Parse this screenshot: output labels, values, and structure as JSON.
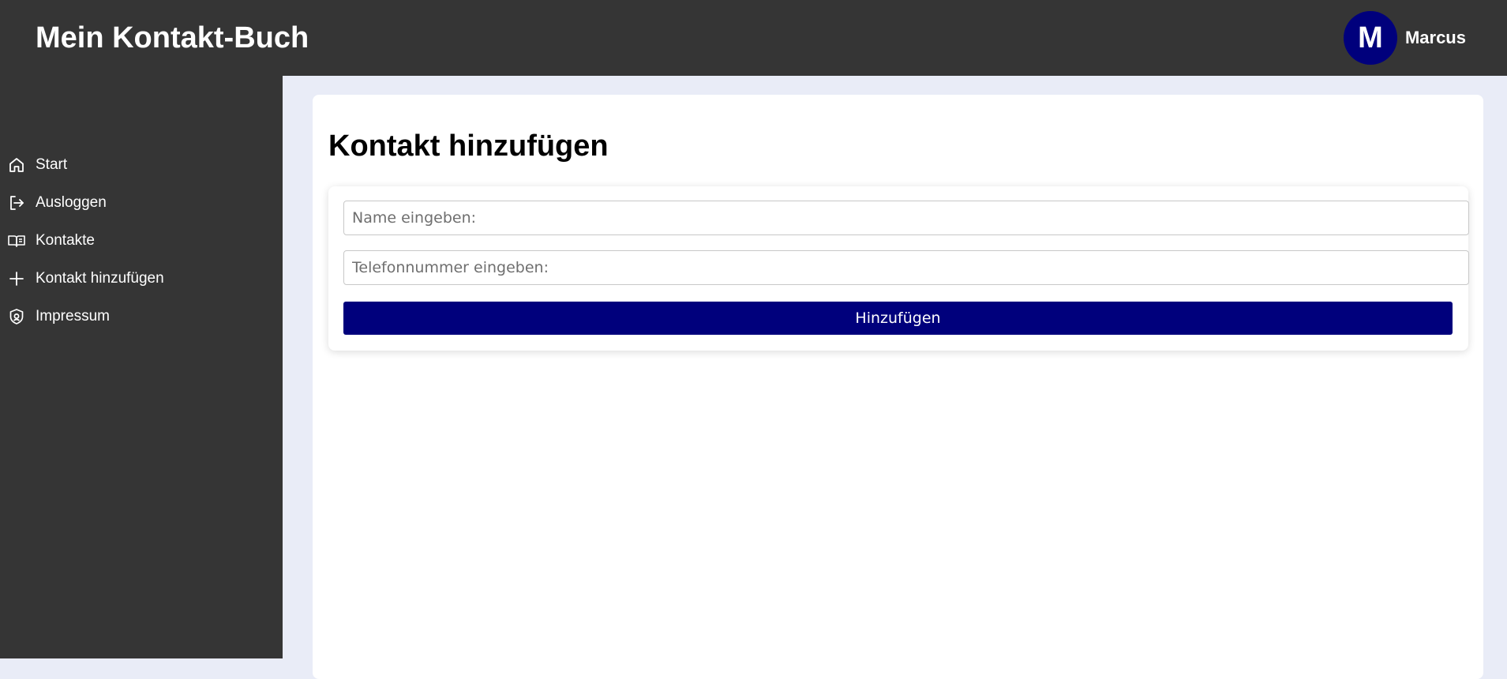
{
  "header": {
    "app_title": "Mein Kontakt-Buch",
    "avatar_initial": "M",
    "user_name": "Marcus"
  },
  "sidebar": {
    "items": [
      {
        "label": "Start",
        "icon": "home-icon"
      },
      {
        "label": "Ausloggen",
        "icon": "logout-icon"
      },
      {
        "label": "Kontakte",
        "icon": "book-icon"
      },
      {
        "label": "Kontakt hinzufügen",
        "icon": "plus-icon"
      },
      {
        "label": "Impressum",
        "icon": "shield-icon"
      }
    ]
  },
  "main": {
    "title": "Kontakt hinzufügen",
    "form": {
      "name_placeholder": "Name eingeben:",
      "name_value": "",
      "phone_placeholder": "Telefonnummer eingeben:",
      "phone_value": "",
      "submit_label": "Hinzufügen"
    }
  },
  "colors": {
    "header_bg": "#353535",
    "sidebar_bg": "#353535",
    "page_bg": "#e9ecf7",
    "accent": "#00007c",
    "card_bg": "#ffffff"
  }
}
